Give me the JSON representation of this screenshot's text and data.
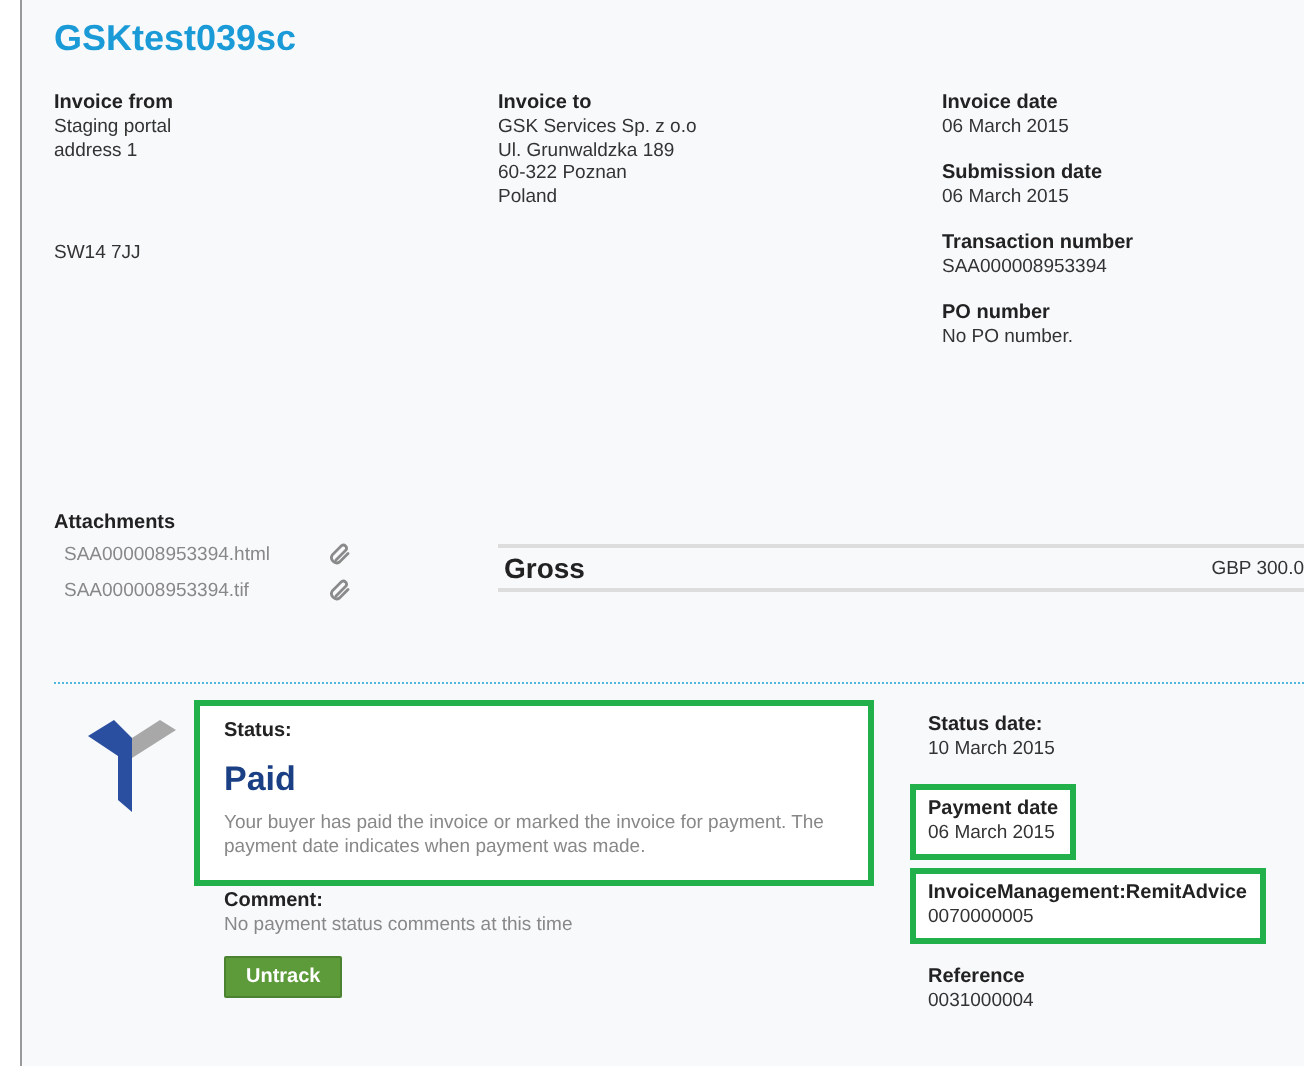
{
  "title": "GSKtest039sc",
  "invoice_from": {
    "label": "Invoice from",
    "lines": [
      "Staging portal",
      "address 1"
    ],
    "postcode": "SW14 7JJ"
  },
  "invoice_to": {
    "label": "Invoice to",
    "lines": [
      "GSK Services Sp. z o.o",
      "Ul. Grunwaldzka 189",
      "60-322 Poznan",
      "Poland"
    ]
  },
  "details": [
    {
      "label": "Invoice date",
      "value": "06 March 2015"
    },
    {
      "label": "Submission date",
      "value": "06 March 2015"
    },
    {
      "label": "Transaction number",
      "value": "SAA000008953394"
    },
    {
      "label": "PO number",
      "value": "No PO number."
    }
  ],
  "attachments": {
    "label": "Attachments",
    "files": [
      "SAA000008953394.html",
      "SAA000008953394.tif"
    ]
  },
  "gross": {
    "label": "Gross",
    "value": "GBP 300.0"
  },
  "status": {
    "label": "Status:",
    "value": "Paid",
    "description": "Your buyer has paid the invoice or marked the invoice for payment. The payment date indicates when payment was made.",
    "highlighted": true,
    "comment_label": "Comment:",
    "comment": "No payment status comments at this time",
    "button": "Untrack"
  },
  "status_fields": [
    {
      "label": "Status date:",
      "value": "10 March 2015",
      "highlighted": false
    },
    {
      "label": "Payment date",
      "value": "06 March 2015",
      "highlighted": true
    },
    {
      "label": "InvoiceManagement:RemitAdvice",
      "value": "0070000005",
      "highlighted": true
    },
    {
      "label": "Reference",
      "value": "0031000004",
      "highlighted": false
    }
  ]
}
